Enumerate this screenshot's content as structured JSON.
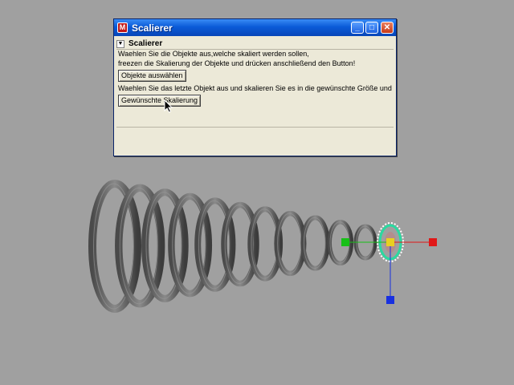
{
  "window": {
    "title": "Scalierer",
    "icon": "maya-app-icon",
    "controls": {
      "minimize": "_",
      "maximize": "□",
      "close": "✕"
    }
  },
  "panel": {
    "section_title": "Scalierer",
    "instruction_1": "Waehlen Sie die Objekte aus,welche skaliert werden sollen,",
    "instruction_2": "freezen die Skalierung der Objekte und drücken anschließend den Button!",
    "select_button": "Objekte auswählen",
    "instruction_3": "Waehlen Sie das letzte Objekt aus und skalieren Sie es in die gewünschte Größe und drück",
    "scale_button": "Gewünschte Skalierung"
  },
  "colors": {
    "viewport_bg": "#a0a0a0",
    "torus": "#6e6e6e",
    "selection_highlight": "#2bd9a0",
    "axis_x": "#e01818",
    "axis_y": "#18c018",
    "axis_z": "#1830e0",
    "pivot": "#e8d020"
  }
}
